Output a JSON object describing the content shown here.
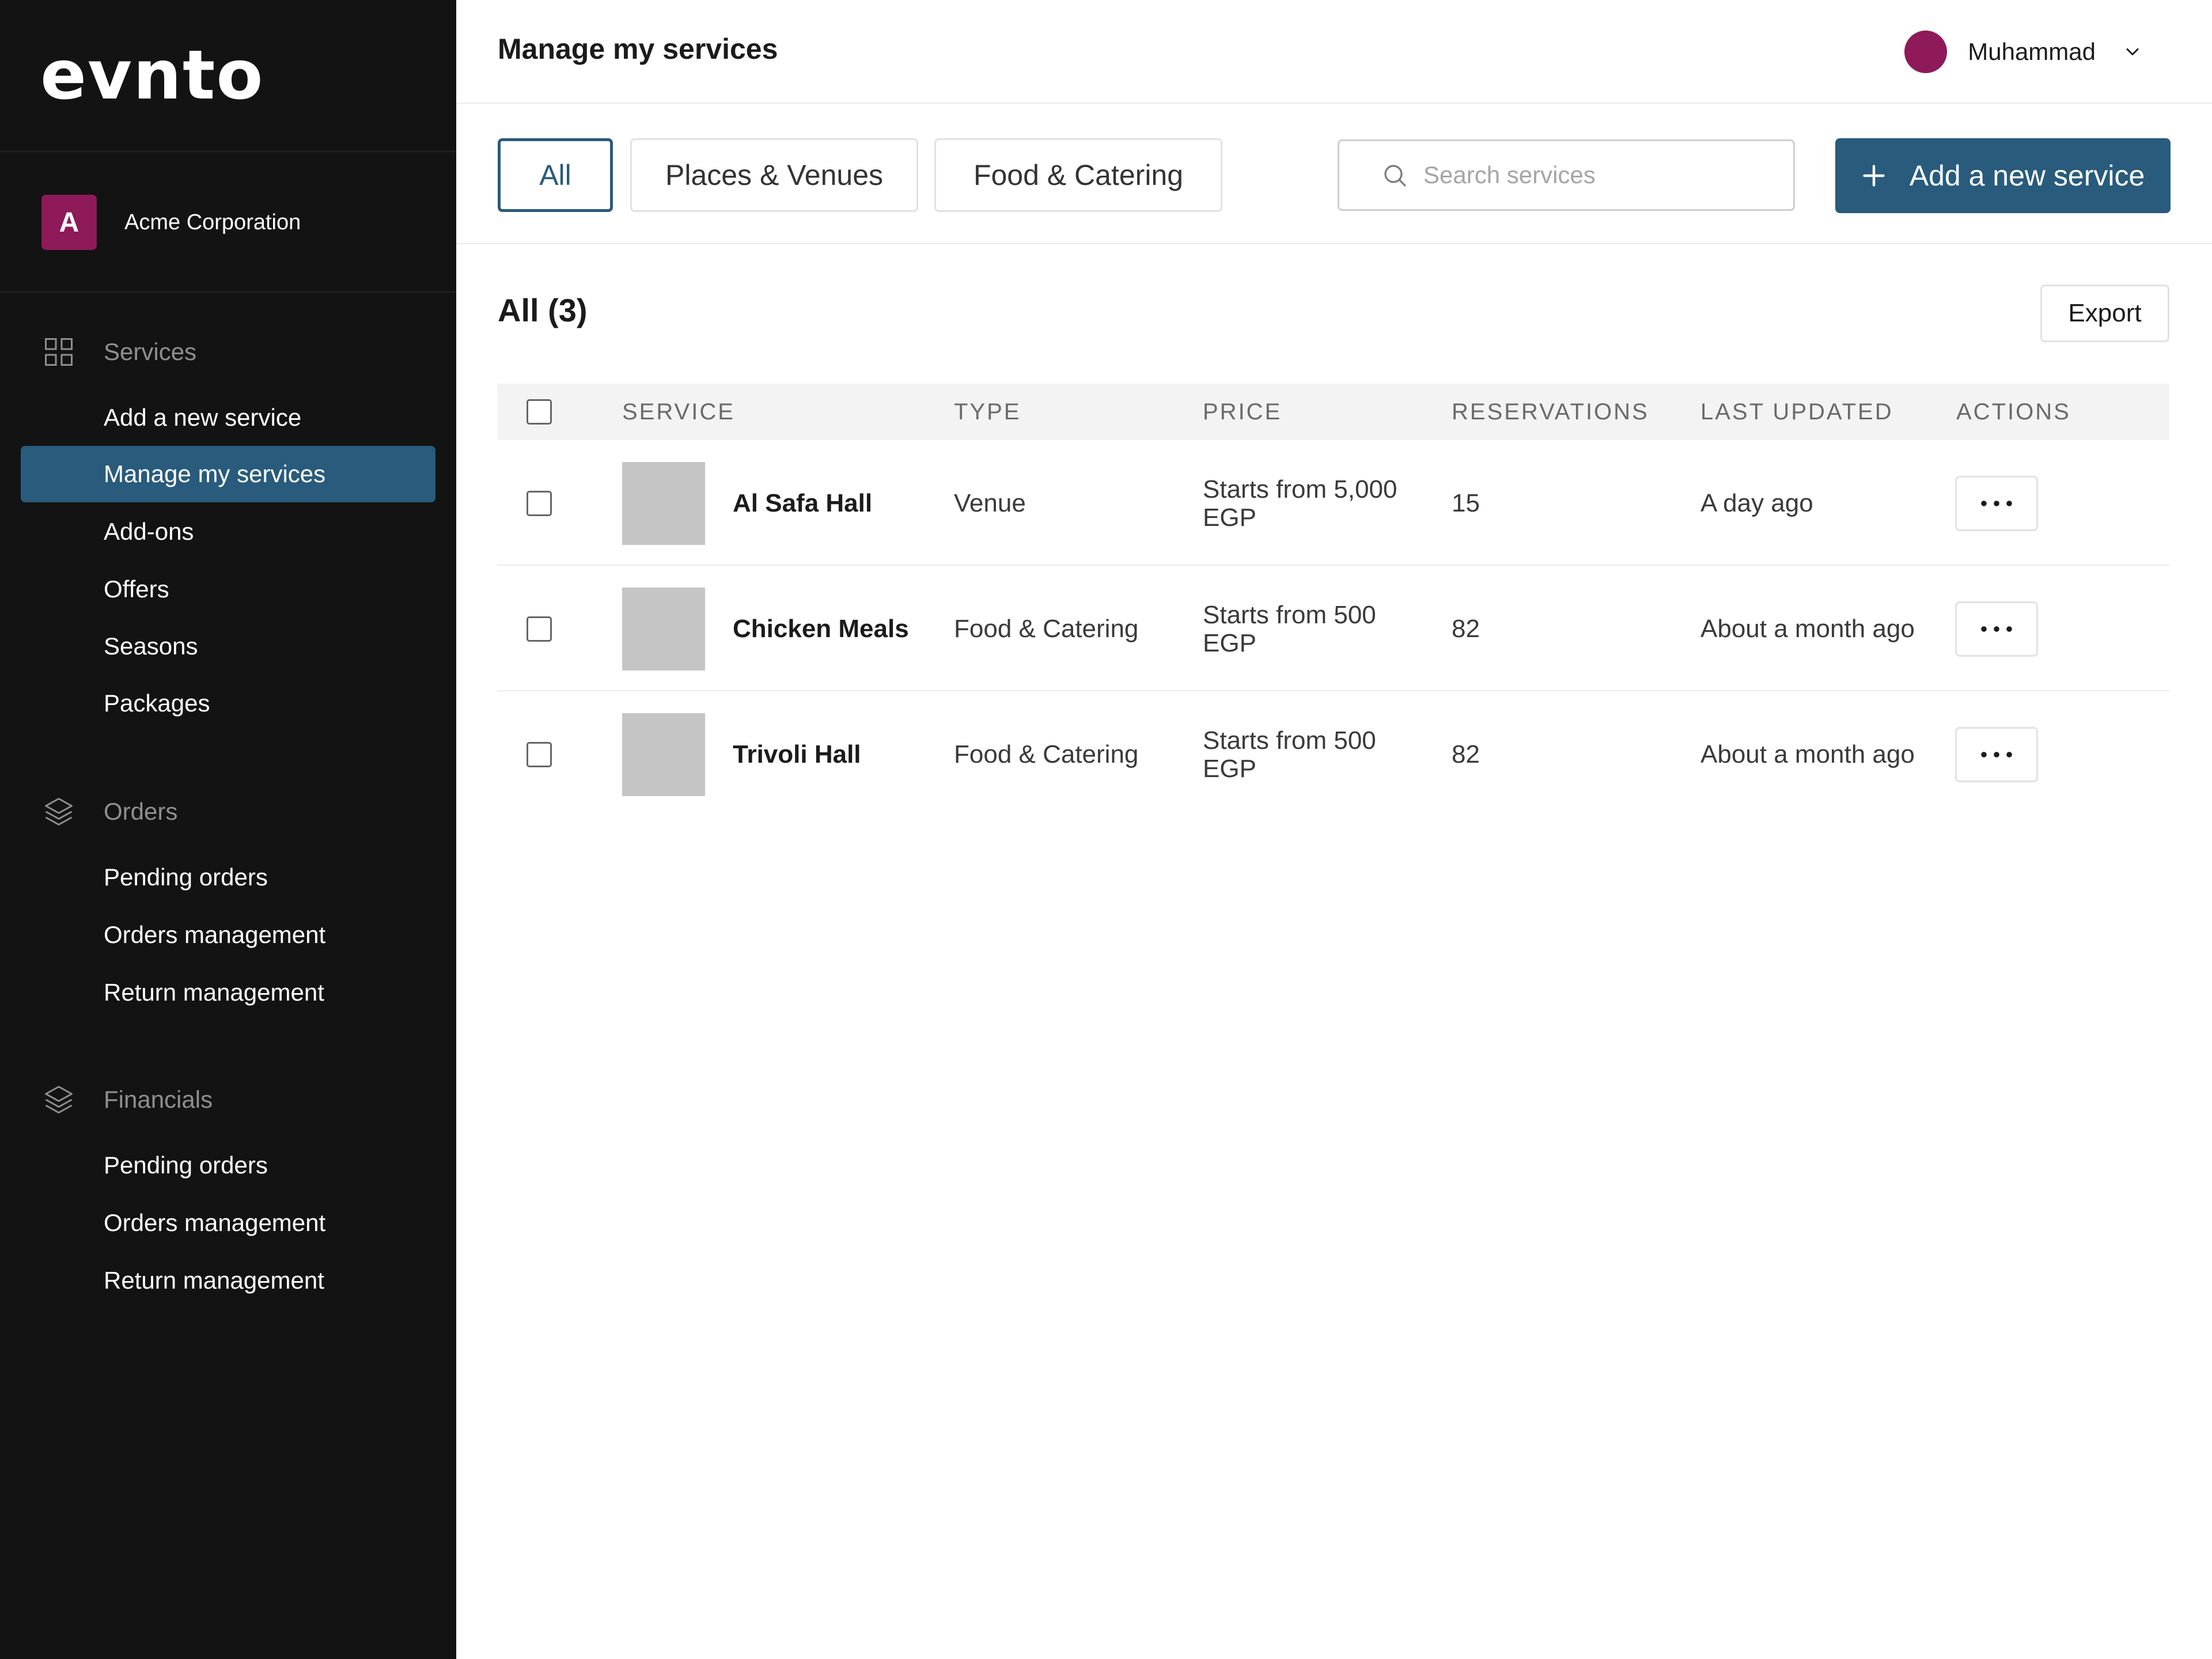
{
  "app": {
    "logo": "evnto"
  },
  "org": {
    "initial": "A",
    "name": "Acme Corporation",
    "color": "#8e1a5a"
  },
  "sidebar": {
    "sections": [
      {
        "label": "Services",
        "icon": "grid-icon",
        "items": [
          {
            "label": "Add a new service",
            "active": false
          },
          {
            "label": "Manage my services",
            "active": true
          },
          {
            "label": "Add-ons",
            "active": false
          },
          {
            "label": "Offers",
            "active": false
          },
          {
            "label": "Seasons",
            "active": false
          },
          {
            "label": "Packages",
            "active": false
          }
        ]
      },
      {
        "label": "Orders",
        "icon": "layers-icon",
        "items": [
          {
            "label": "Pending orders"
          },
          {
            "label": "Orders management"
          },
          {
            "label": "Return management"
          }
        ]
      },
      {
        "label": "Financials",
        "icon": "layers-icon",
        "items": [
          {
            "label": "Pending orders"
          },
          {
            "label": "Orders management"
          },
          {
            "label": "Return management"
          }
        ]
      }
    ]
  },
  "header": {
    "title": "Manage my services",
    "user_name": "Muhammad"
  },
  "filters": {
    "tabs": [
      {
        "label": "All",
        "active": true
      },
      {
        "label": "Places & Venues",
        "active": false
      },
      {
        "label": "Food & Catering",
        "active": false
      }
    ],
    "search_placeholder": "Search services",
    "add_label": "Add a new service"
  },
  "list": {
    "title": "All (3)",
    "export_label": "Export",
    "columns": [
      "SERVICE",
      "TYPE",
      "PRICE",
      "RESERVATIONS",
      "LAST UPDATED",
      "ACTIONS"
    ],
    "rows": [
      {
        "name": "Al Safa Hall",
        "type": "Venue",
        "price_line1": "Starts from 5,000",
        "price_line2": "EGP",
        "reservations": "15",
        "updated": "A day ago"
      },
      {
        "name": "Chicken Meals",
        "type": "Food & Catering",
        "price_line1": "Starts from 500",
        "price_line2": "EGP",
        "reservations": "82",
        "updated": "About a month ago"
      },
      {
        "name": "Trivoli Hall",
        "type": "Food & Catering",
        "price_line1": "Starts from 500",
        "price_line2": "EGP",
        "reservations": "82",
        "updated": "About a month ago"
      }
    ]
  },
  "colors": {
    "accent": "#285b7c",
    "brand": "#8e1a5a",
    "sidebar_bg": "#131313"
  }
}
